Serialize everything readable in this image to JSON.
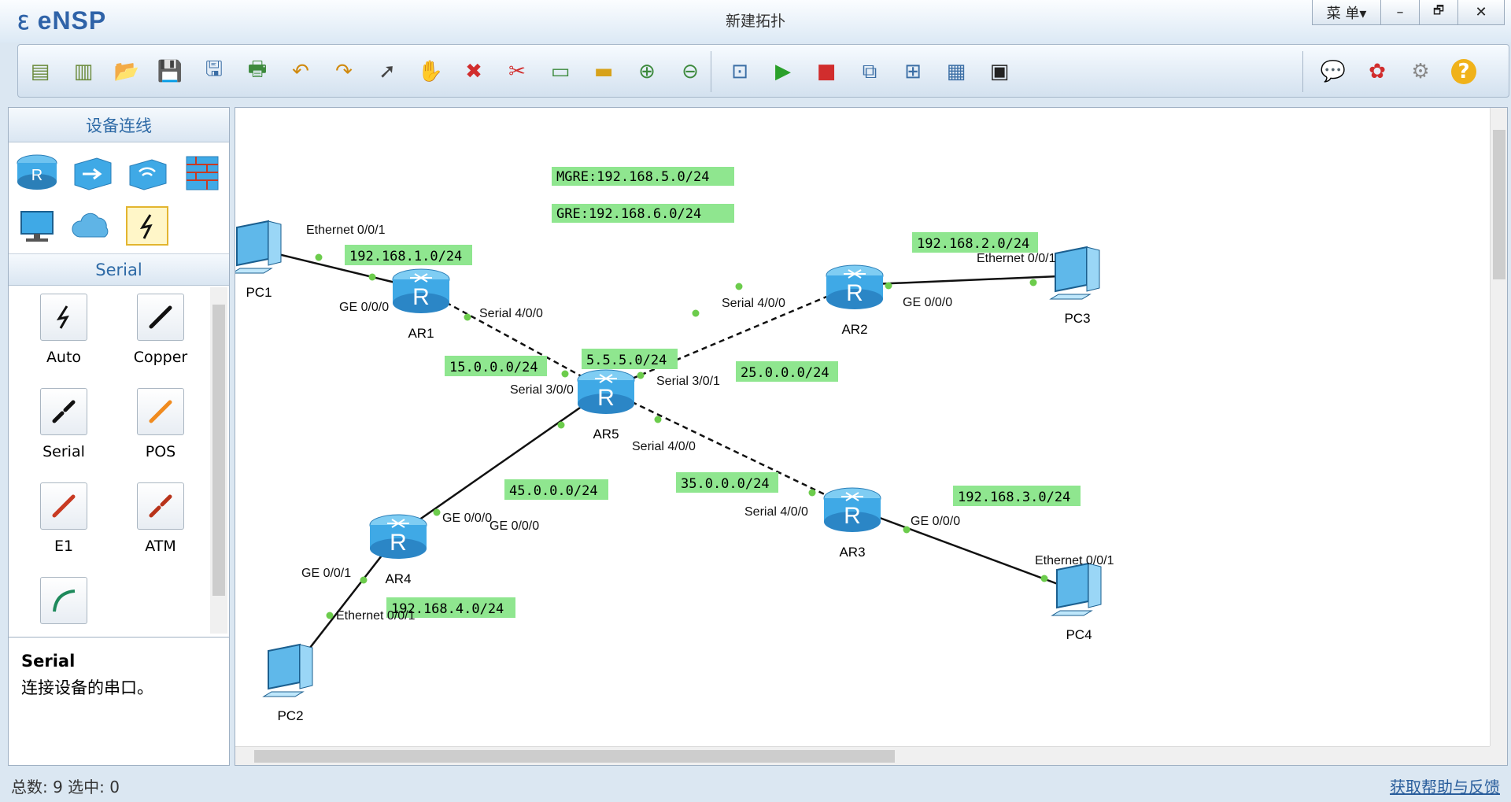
{
  "app": {
    "logo": "eNSP",
    "title": "新建拓扑",
    "menu_label": "菜 单▾",
    "minimize": "–",
    "restore": "🗗",
    "close": "✕"
  },
  "toolbar": {
    "icons": [
      "new-topology-icon",
      "new-sample-icon",
      "open-icon",
      "save-icon",
      "save-as-icon",
      "print-icon",
      "undo-icon",
      "redo-icon",
      "select-icon",
      "pan-icon",
      "delete-icon",
      "delete-all-links-icon",
      "text-note-icon",
      "rectangle-icon",
      "zoom-in-icon",
      "zoom-out-icon",
      "fit-icon",
      "start-icon",
      "stop-icon",
      "capture-icon",
      "layout-icon",
      "grid-icon",
      "terminal-icon",
      "chat-icon",
      "huawei-icon",
      "settings-icon",
      "help-icon"
    ]
  },
  "left_panel": {
    "title": "设备连线",
    "device_icons": [
      "router-icon",
      "switch-icon",
      "wireless-icon",
      "firewall-icon",
      "pc-icon",
      "cloud-icon",
      "cable-icon"
    ],
    "subtitle": "Serial",
    "cables": [
      {
        "label": "Auto",
        "color": "#000000"
      },
      {
        "label": "Copper",
        "color": "#111111"
      },
      {
        "label": "Serial",
        "color": "#111111"
      },
      {
        "label": "POS",
        "color": "#f08b1f"
      },
      {
        "label": "E1",
        "color": "#c83a22"
      },
      {
        "label": "ATM",
        "color": "#b8331a"
      },
      {
        "label": "",
        "color": "#1e8a5c"
      }
    ],
    "desc_title": "Serial",
    "desc_text": "连接设备的串口。"
  },
  "topology": {
    "devices": [
      "AR1",
      "AR2",
      "AR3",
      "AR4",
      "AR5",
      "PC1",
      "PC2",
      "PC3",
      "PC4"
    ],
    "networks": [
      "MGRE:192.168.5.0/24",
      "GRE:192.168.6.0/24",
      "192.168.1.0/24",
      "192.168.2.0/24",
      "192.168.3.0/24",
      "192.168.4.0/24",
      "15.0.0.0/24",
      "25.0.0.0/24",
      "35.0.0.0/24",
      "45.0.0.0/24",
      "5.5.5.0/24"
    ],
    "ports": [
      "Ethernet 0/0/1",
      "GE 0/0/0",
      "Serial 4/0/0",
      "Serial 3/0/0",
      "Serial 3/0/1",
      "Serial 4/0/0",
      "GE 0/0/0",
      "Ethernet 0/0/1",
      "Serial 4/0/0",
      "Serial 4/0/0",
      "GE 0/0/0",
      "Ethernet 0/0/1",
      "GE 0/0/0",
      "GE 0/0/0",
      "GE 0/0/1",
      "Ethernet 0/0/1"
    ]
  },
  "status": {
    "summary": "总数: 9 选中: 0",
    "help": "获取帮助与反馈"
  },
  "colors": {
    "label_bg": "#8fe68f",
    "accent": "#2e6aa6",
    "router": "#3fa9e6"
  }
}
